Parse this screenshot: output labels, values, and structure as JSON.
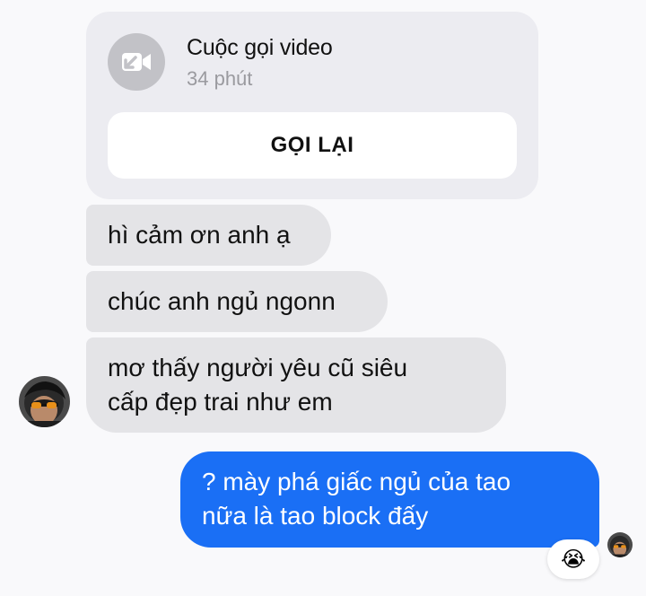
{
  "call_card": {
    "title": "Cuộc gọi video",
    "duration": "34 phút",
    "button_label": "GỌI LẠI",
    "icon": "video-camera-off-icon"
  },
  "messages": [
    {
      "sender": "contact",
      "line1": "hì cảm ơn anh ạ",
      "line2": ""
    },
    {
      "sender": "contact",
      "line1": "chúc anh ngủ ngonn",
      "line2": ""
    },
    {
      "sender": "contact",
      "line1": "mơ thấy người yêu cũ siêu",
      "line2": "cấp đẹp trai như em"
    },
    {
      "sender": "me",
      "line1": "? mày phá giấc ngủ của tao",
      "line2": "nữa là tao block đấy"
    }
  ],
  "reaction": {
    "emoji": "😭"
  },
  "colors": {
    "background": "#f9f9fb",
    "incoming_bubble": "#e4e4e7",
    "outgoing_bubble": "#1a6ff5",
    "call_card": "#ececf1"
  }
}
